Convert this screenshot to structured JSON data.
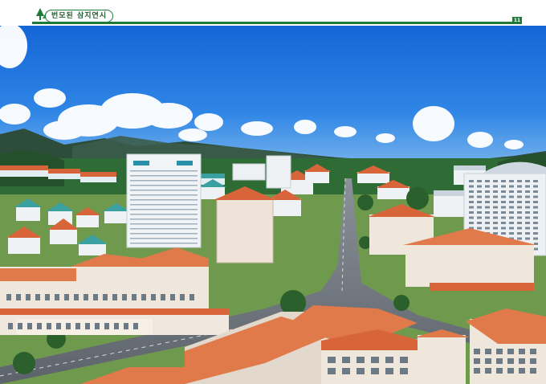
{
  "header": {
    "title": "번모된 삼지연시",
    "page_number": "11",
    "accent_color": "#1f7a3a",
    "icon": "tree-icon"
  },
  "photo": {
    "subject": "town-aerial-photo",
    "sky_color": "#1d6fd8",
    "roof_color": "#e07a4a"
  }
}
